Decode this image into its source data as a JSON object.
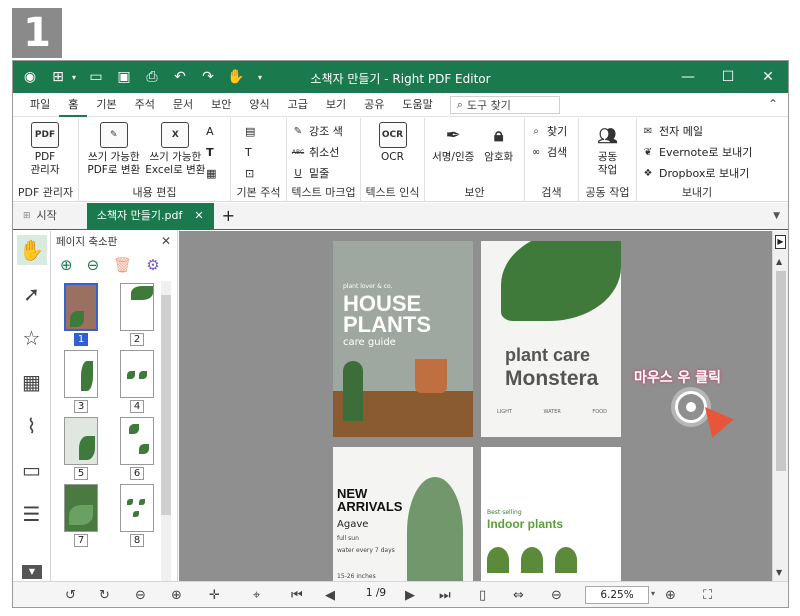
{
  "step_number": "1",
  "app": {
    "title": "소책자 만들기 - Right PDF Editor",
    "accent_color": "#1a7a4e"
  },
  "titlebar_icons": [
    "app-logo-icon",
    "new-document-icon",
    "open-folder-icon",
    "save-icon",
    "print-icon",
    "undo-icon",
    "redo-icon",
    "hand-tool-icon"
  ],
  "menu": {
    "tabs": [
      "파일",
      "홈",
      "기본",
      "주석",
      "문서",
      "보안",
      "양식",
      "고급",
      "보기",
      "공유",
      "도움말"
    ],
    "active_tab": "홈",
    "search_placeholder": "도구 찾기"
  },
  "ribbon": {
    "groups": [
      {
        "label": "PDF 관리자",
        "buttons": [
          "PDF\n관리자"
        ]
      },
      {
        "label": "내용 편집",
        "buttons": [
          "쓰기 가능한\nPDF로 변환",
          "쓰기 가능한\nExcel로 변환"
        ]
      },
      {
        "label": "기본 주석"
      },
      {
        "label": "텍스트 마크업",
        "buttons": [
          "강조 색",
          "취소선",
          "밑줄"
        ]
      },
      {
        "label": "텍스트 인식",
        "buttons": [
          "OCR"
        ]
      },
      {
        "label": "보안",
        "buttons": [
          "서명/인증",
          "암호화"
        ]
      },
      {
        "label": "검색",
        "buttons": [
          "찾기",
          "검색"
        ]
      },
      {
        "label": "공동 작업",
        "buttons": [
          "공동\n작업"
        ]
      },
      {
        "label": "보내기",
        "buttons": [
          "전자 메일",
          "Evernote로 보내기",
          "Dropbox로 보내기"
        ]
      }
    ],
    "ocr_icon_text": "OCR",
    "pdf_icon_text": "PDF",
    "strike_icon_text": "ABC",
    "underline_icon_text": "U"
  },
  "doc_tabs": {
    "start_label": "시작",
    "active_label": "소책자 만들기.pdf",
    "add_label": "+"
  },
  "thumbnail_panel": {
    "title": "페이지 축소판",
    "pages": [
      "1",
      "2",
      "3",
      "4",
      "5",
      "6",
      "7",
      "8"
    ],
    "selected_page": "1"
  },
  "pages": {
    "p1": {
      "small": "plant lover & co.",
      "title": "HOUSE\nPLANTS",
      "subtitle": "care guide"
    },
    "p2": {
      "line1": "plant care",
      "line2": "Monstera",
      "col1": "LIGHT",
      "col2": "WATER",
      "col3": "FOOD"
    },
    "p3": {
      "title": "NEW\nARRIVALS",
      "name": "Agave",
      "bullet1": "full sun",
      "bullet2": "water every 7 days",
      "size": "15-26 inches"
    },
    "p4": {
      "tag": "Best selling",
      "title": "Indoor plants"
    }
  },
  "annotation": "마우스 우 클릭",
  "status": {
    "page_indicator": "1 /9",
    "zoom": "6.25%"
  }
}
